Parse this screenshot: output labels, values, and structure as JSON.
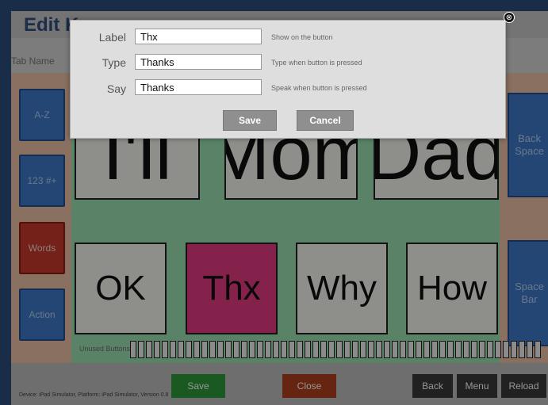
{
  "screen": {
    "title": "Edit K",
    "tab_name_label": "Tab Name",
    "left_buttons": [
      "A-Z",
      "123 #+",
      "Words",
      "Action"
    ],
    "right_buttons": [
      "Back Space",
      "Space Bar"
    ],
    "tiles_top": [
      "I'll",
      "Mom",
      "Dad"
    ],
    "tiles_bottom": [
      "OK",
      "Thx",
      "Why",
      "How"
    ],
    "unused_label": "Unused Buttons",
    "bottom": {
      "save": "Save",
      "close": "Close",
      "back": "Back",
      "menu": "Menu",
      "reload": "Reload"
    },
    "debug_text": "Device: iPad Simulator, Platform: iPad Simulator, Version 0.8"
  },
  "dialog": {
    "label": {
      "caption": "Label",
      "value": "Thx",
      "hint": "Show on the button"
    },
    "type": {
      "caption": "Type",
      "value": "Thanks",
      "hint": "Type when button is pressed"
    },
    "say": {
      "caption": "Say",
      "value": "Thanks",
      "hint": "Speak when button is pressed"
    },
    "save_label": "Save",
    "cancel_label": "Cancel",
    "close_icon": "⊗"
  },
  "colors": {
    "tile_highlight": "#e63c82",
    "side_button": "#3f79c8",
    "words_button": "#c9392d",
    "save_button": "#2e9a3a",
    "close_button": "#b0401c"
  }
}
